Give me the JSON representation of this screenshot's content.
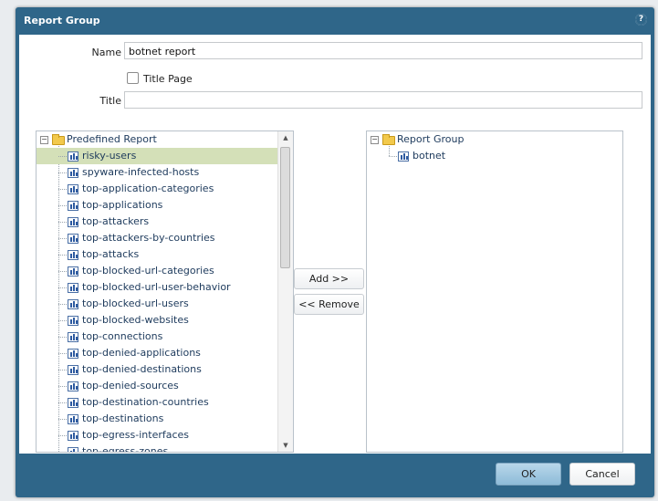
{
  "dialog": {
    "title": "Report Group",
    "help_icon": "help-icon"
  },
  "form": {
    "name_label": "Name",
    "name_value": "botnet report",
    "title_page_label": "Title Page",
    "title_page_checked": false,
    "title_label": "Title",
    "title_value": ""
  },
  "left_tree": {
    "root_label": "Predefined Report",
    "items": [
      "risky-users",
      "spyware-infected-hosts",
      "top-application-categories",
      "top-applications",
      "top-attackers",
      "top-attackers-by-countries",
      "top-attacks",
      "top-blocked-url-categories",
      "top-blocked-url-user-behavior",
      "top-blocked-url-users",
      "top-blocked-websites",
      "top-connections",
      "top-denied-applications",
      "top-denied-destinations",
      "top-denied-sources",
      "top-destination-countries",
      "top-destinations",
      "top-egress-interfaces",
      "top-egress-zones"
    ],
    "selected": "risky-users"
  },
  "middle_buttons": {
    "add_label": "Add >>",
    "remove_label": "<< Remove"
  },
  "right_tree": {
    "root_label": "Report Group",
    "items": [
      "botnet"
    ]
  },
  "footer": {
    "ok_label": "OK",
    "cancel_label": "Cancel"
  },
  "colors": {
    "header_bg": "#2f6689",
    "selection_bg": "#d4e0b8",
    "ok_bg": "#9cc6e0"
  }
}
